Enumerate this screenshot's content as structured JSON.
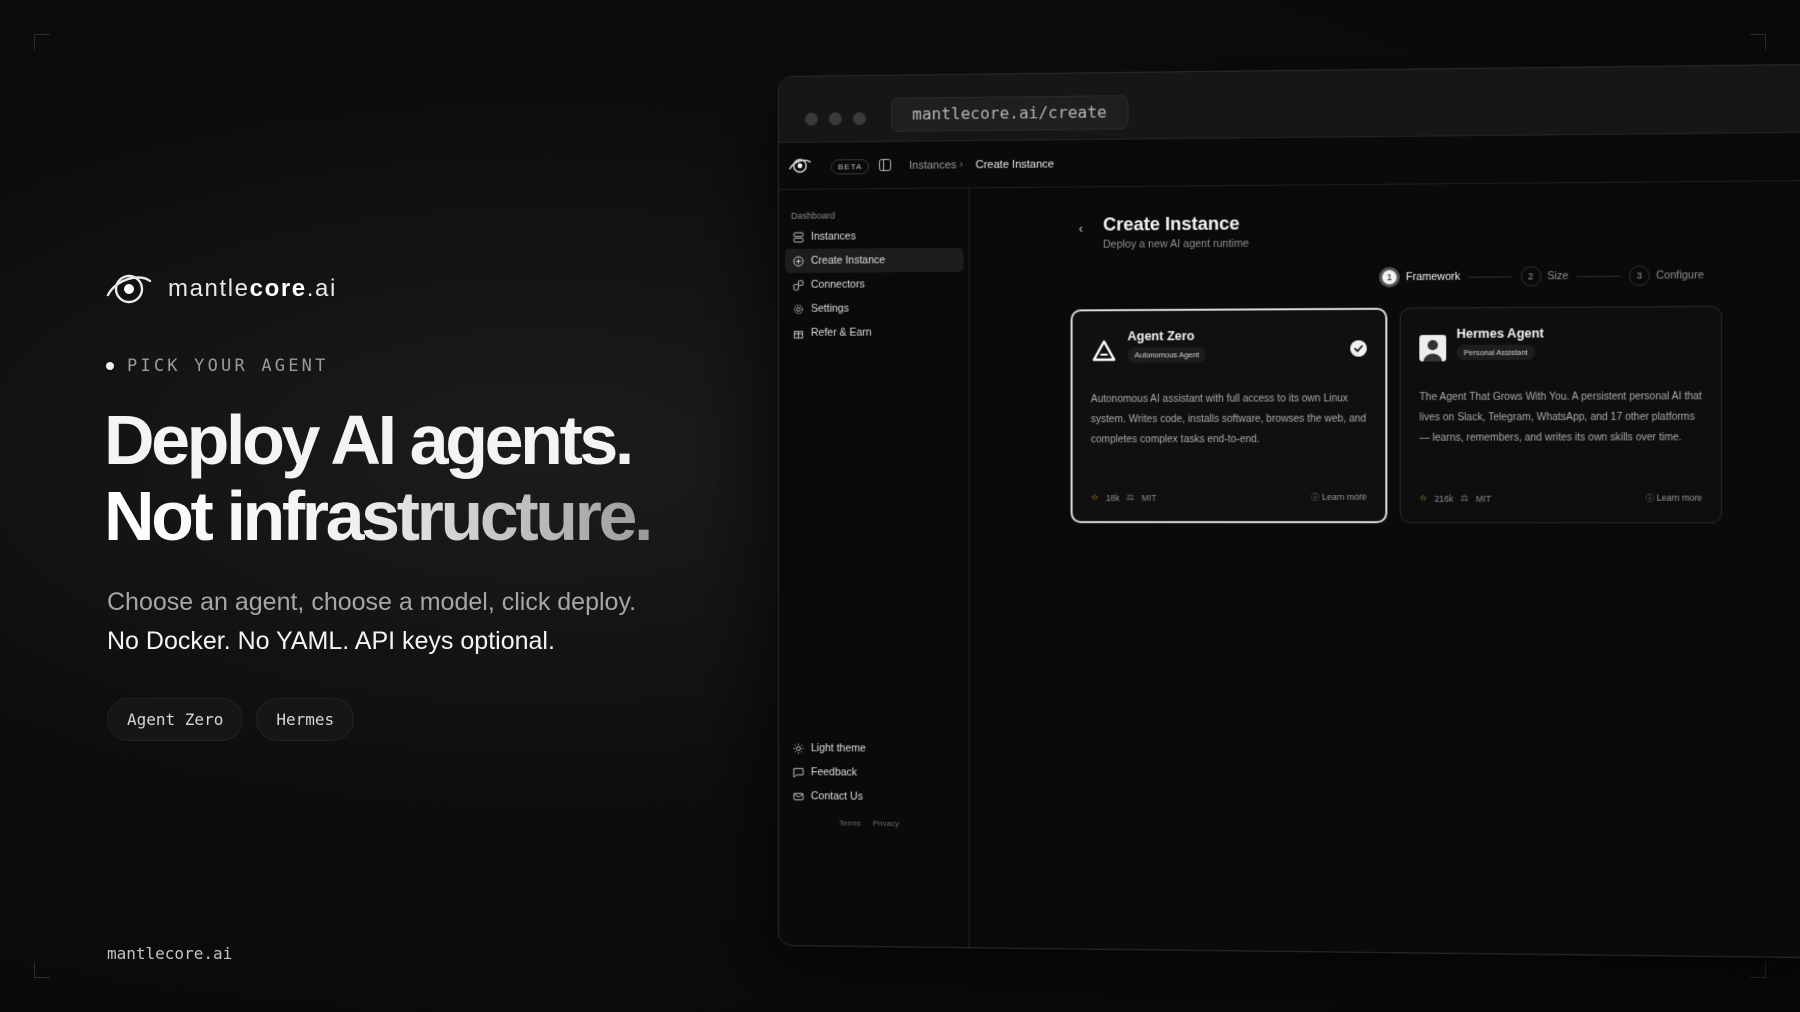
{
  "brand": {
    "name_light": "mantle",
    "name_bold": "core",
    "name_tld": ".ai"
  },
  "eyebrow": "PICK YOUR AGENT",
  "headline": {
    "line1": "Deploy AI agents.",
    "line2": "Not infrastructure."
  },
  "subtitle": {
    "line1": "Choose an agent, choose a model, click deploy.",
    "line2": "No Docker. No YAML. API keys optional."
  },
  "chips": [
    "Agent Zero",
    "Hermes"
  ],
  "footer_domain": "mantlecore.ai",
  "browser": {
    "url": "mantlecore.ai/create",
    "beta": "BETA",
    "breadcrumb": {
      "parent": "Instances",
      "separator": "›",
      "current": "Create Instance"
    }
  },
  "sidebar": {
    "section": "Dashboard",
    "items": [
      {
        "label": "Instances",
        "icon": "server-icon"
      },
      {
        "label": "Create Instance",
        "icon": "plus-circle-icon",
        "active": true
      },
      {
        "label": "Connectors",
        "icon": "plug-icon"
      },
      {
        "label": "Settings",
        "icon": "gear-icon"
      },
      {
        "label": "Refer & Earn",
        "icon": "gift-icon"
      }
    ],
    "bottom": [
      {
        "label": "Light theme",
        "icon": "sun-icon"
      },
      {
        "label": "Feedback",
        "icon": "message-icon"
      },
      {
        "label": "Contact Us",
        "icon": "mail-icon"
      }
    ],
    "footer_links": [
      "Terms",
      "Privacy"
    ]
  },
  "main": {
    "back": "‹",
    "title": "Create Instance",
    "subtitle": "Deploy a new AI agent runtime",
    "steps": [
      {
        "num": "1",
        "label": "Framework",
        "active": true
      },
      {
        "num": "2",
        "label": "Size"
      },
      {
        "num": "3",
        "label": "Configure"
      }
    ],
    "cards": [
      {
        "title": "Agent Zero",
        "badge": "Autonomous Agent",
        "description": "Autonomous AI assistant with full access to its own Linux system. Writes code, installs software, browses the web, and completes complex tasks end-to-end.",
        "stars": "18k",
        "license": "MIT",
        "learn": "Learn more",
        "selected": true
      },
      {
        "title": "Hermes Agent",
        "badge": "Personal Assistant",
        "description": "The Agent That Grows With You. A persistent personal AI that lives on Slack, Telegram, WhatsApp, and 17 other platforms — learns, remembers, and writes its own skills over time.",
        "stars": "216k",
        "license": "MIT",
        "learn": "Learn more",
        "selected": false
      }
    ]
  },
  "colors": {
    "background": "#0b0b0b",
    "accent_star": "#e0a93a",
    "text": "#f4f4f4"
  }
}
